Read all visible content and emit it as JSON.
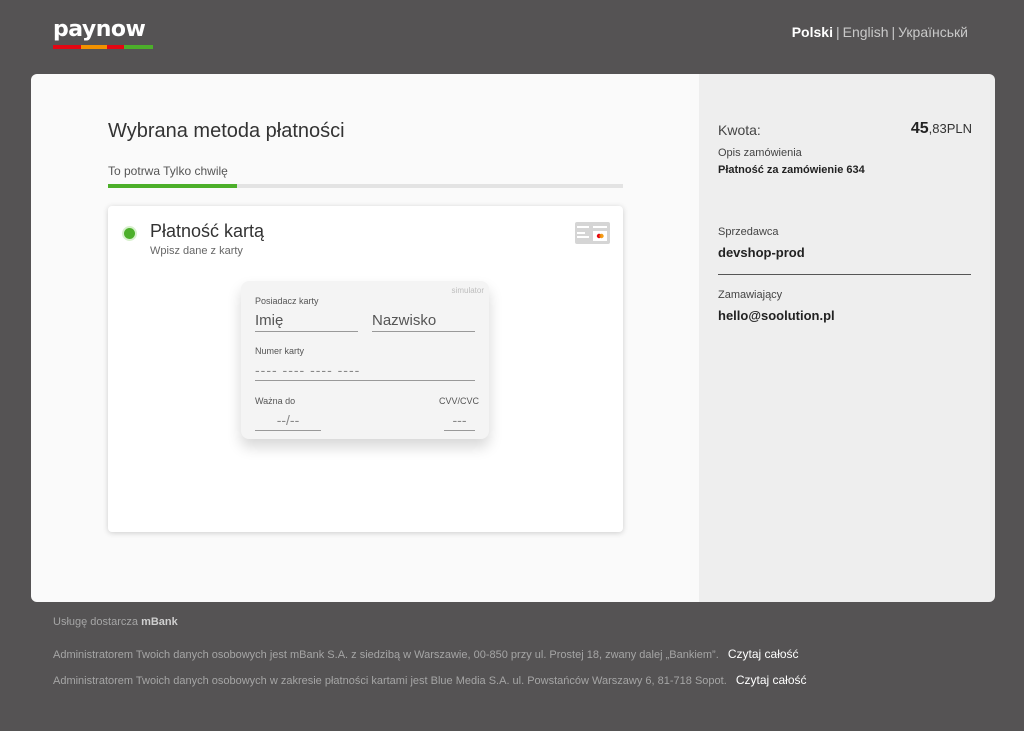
{
  "brand": {
    "logo_text": "paynow",
    "bar_colors": [
      "#e30613",
      "#f29100",
      "#e30613",
      "#4caf2a"
    ]
  },
  "languages": [
    {
      "label": "Polski",
      "active": true
    },
    {
      "label": "English",
      "active": false
    },
    {
      "label": "Українськй",
      "active": false
    }
  ],
  "language_separator": "|",
  "payment": {
    "heading": "Wybrana metoda płatności",
    "progress_label": "To potrwa Tylko chwilę",
    "progress_value": 0.25,
    "method": {
      "title": "Płatność kartą",
      "subtitle": "Wpisz dane z karty",
      "icon": "credit-card-icon"
    },
    "form": {
      "simulator_label": "simulator",
      "holder_label": "Posiadacz karty",
      "first_name_placeholder": "Imię",
      "last_name_placeholder": "Nazwisko",
      "card_number_label": "Numer karty",
      "card_number_placeholder": "---- ---- ---- ----",
      "expiry_label": "Ważna do",
      "expiry_placeholder": "--/--",
      "cvv_label": "CVV/CVC",
      "cvv_placeholder": "---"
    }
  },
  "summary": {
    "amount_label": "Kwota:",
    "amount_integer": "45",
    "amount_fraction": ",83",
    "currency": "PLN",
    "order_label": "Opis zamówienia",
    "order_value": "Płatność za zamówienie 634",
    "seller_label": "Sprzedawca",
    "seller_value": "devshop-prod",
    "buyer_label": "Zamawiający",
    "buyer_value": "hello@soolution.pl"
  },
  "footer": {
    "provider_prefix": "Usługę dostarcza",
    "provider_name": "mBank",
    "notice1": "Administratorem Twoich danych osobowych jest mBank S.A. z siedzibą w Warszawie, 00-850 przy ul. Prostej 18, zwany dalej „Bankiem”.",
    "notice2": "Administratorem Twoich danych osobowych w zakresie płatności kartami jest Blue Media S.A. ul. Powstańców Warszawy 6, 81-718 Sopot.",
    "read_more": "Czytaj całość"
  },
  "colors": {
    "accent": "#4caf2a",
    "background": "#555354"
  }
}
